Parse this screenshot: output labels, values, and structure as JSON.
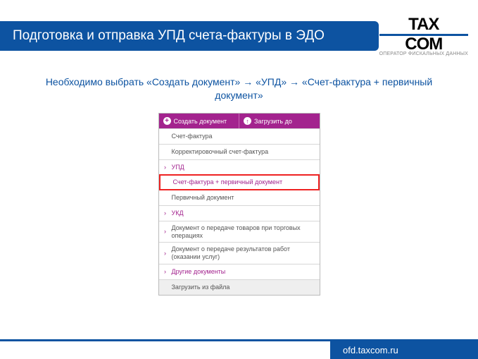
{
  "header": {
    "title": "Подготовка и отправка УПД счета-фактуры в ЭДО",
    "logo_line1": "TAX",
    "logo_line2": "COM",
    "logo_sub": "ОПЕРАТОР ФИСКАЛЬНЫХ ДАННЫХ"
  },
  "instruction": "Необходимо выбрать «Создать документ» → «УПД» → «Счет-фактура + первичный документ»",
  "app": {
    "btn_create": "Создать документ",
    "btn_upload": "Загрузить до",
    "items": [
      {
        "label": "Счет-фактура",
        "arrow": false,
        "cat": false,
        "sel": false
      },
      {
        "label": "Корректировочный счет-фактура",
        "arrow": false,
        "cat": false,
        "sel": false
      },
      {
        "label": "УПД",
        "arrow": true,
        "cat": true,
        "sel": false
      },
      {
        "label": "Счет-фактура + первичный документ",
        "arrow": false,
        "cat": false,
        "sel": true
      },
      {
        "label": "Первичный документ",
        "arrow": false,
        "cat": false,
        "sel": false
      },
      {
        "label": "УКД",
        "arrow": true,
        "cat": true,
        "sel": false
      },
      {
        "label": "Документ о передаче товаров при торговых операциях",
        "arrow": true,
        "cat": false,
        "sel": false
      },
      {
        "label": "Документ о передаче результатов работ (оказании услуг)",
        "arrow": true,
        "cat": false,
        "sel": false
      },
      {
        "label": "Другие документы",
        "arrow": true,
        "cat": true,
        "sel": false
      },
      {
        "label": "Загрузить из файла",
        "arrow": false,
        "cat": false,
        "sel": false,
        "last": true
      }
    ]
  },
  "footer": {
    "url": "ofd.taxcom.ru"
  }
}
